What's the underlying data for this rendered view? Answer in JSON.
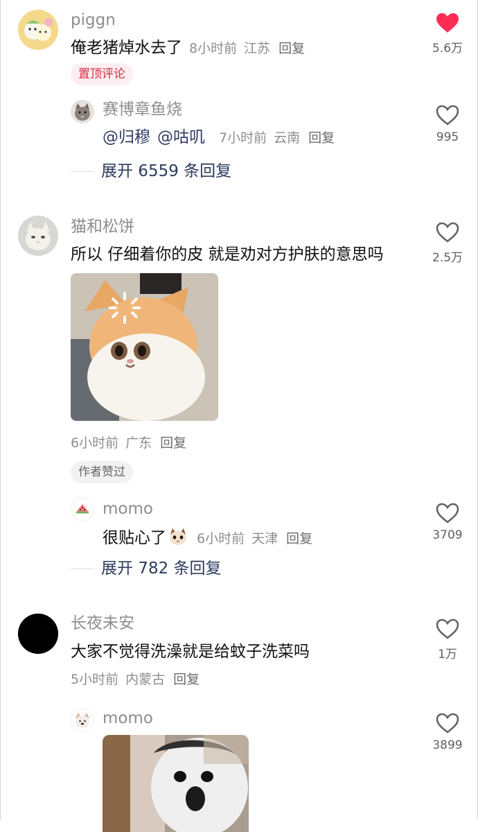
{
  "colors": {
    "liked_heart": "#ff2d55",
    "mention": "#2f3b64",
    "pin_tag_bg": "#fdeef0",
    "pin_tag_text": "#d42f44"
  },
  "comments": [
    {
      "username": "piggn",
      "text": "俺老猪焯水去了",
      "time": "8小时前",
      "location": "江苏",
      "reply_label": "回复",
      "tag": "置顶评论",
      "likes": "5.6万",
      "liked": true,
      "avatar_icon": "cartoon-sumikko-avatar",
      "replies": [
        {
          "username": "赛博章鱼烧",
          "mentions": [
            "@归穆",
            "@咕叽"
          ],
          "time": "7小时前",
          "location": "云南",
          "reply_label": "回复",
          "likes": "995",
          "avatar_icon": "cat-avatar"
        }
      ],
      "expand_label": "展开 6559 条回复"
    },
    {
      "username": "猫和松饼",
      "text": "所以 仔细着你的皮 就是劝对方护肤的意思吗",
      "time": "6小时前",
      "location": "广东",
      "reply_label": "回复",
      "tag": "作者赞过",
      "likes": "2.5万",
      "liked": false,
      "avatar_icon": "white-cat-avatar",
      "image_icon": "orange-kitten-loading-photo",
      "replies": [
        {
          "username": "momo",
          "text": "很贴心了",
          "sticker_icon": "cat-face-sticker",
          "time": "6小时前",
          "location": "天津",
          "reply_label": "回复",
          "likes": "3709",
          "avatar_icon": "watermelon-avatar"
        }
      ],
      "expand_label": "展开 782 条回复"
    },
    {
      "username": "长夜未安",
      "text": "大家不觉得洗澡就是给蚊子洗菜吗",
      "time": "5小时前",
      "location": "内蒙古",
      "reply_label": "回复",
      "likes": "1万",
      "liked": false,
      "avatar_icon": "black-circle-avatar",
      "replies": [
        {
          "username": "momo",
          "likes": "3899",
          "avatar_icon": "dog-avatar",
          "image_icon": "surprised-dog-photo"
        }
      ]
    }
  ]
}
